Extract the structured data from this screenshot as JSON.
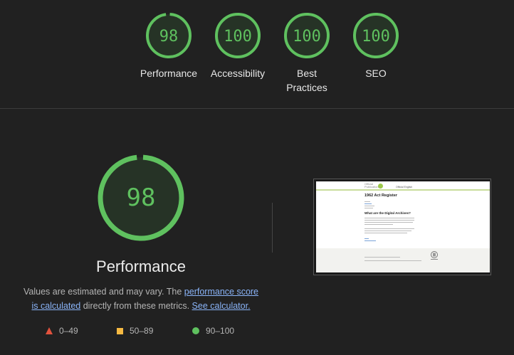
{
  "colors": {
    "background": "#212121",
    "pass": "#5fc15f",
    "average": "#f5b942",
    "fail": "#e1523d",
    "link": "#8ab4f8"
  },
  "categories": [
    {
      "score": "98",
      "label": "Performance",
      "value": 98
    },
    {
      "score": "100",
      "label": "Accessibility",
      "value": 100
    },
    {
      "score": "100",
      "label": "Best Practices",
      "value": 100
    },
    {
      "score": "100",
      "label": "SEO",
      "value": 100
    }
  ],
  "performance": {
    "score": "98",
    "value": 98,
    "title": "Performance",
    "desc_prefix": "Values are estimated and may vary. The ",
    "score_link": "performance score is calculated",
    "desc_middle": " directly from these metrics. ",
    "calculator_link": "See calculator."
  },
  "legend": [
    {
      "range": "0–49",
      "icon": "red-triangle-icon"
    },
    {
      "range": "50–89",
      "icon": "orange-square-icon"
    },
    {
      "range": "90–100",
      "icon": "green-circle-icon"
    }
  ],
  "screenshot": {
    "logo_text": "Official Publications",
    "header_link": "Official English",
    "heading": "1962 Act Register",
    "subheading": "What are the Digital Archives?"
  }
}
